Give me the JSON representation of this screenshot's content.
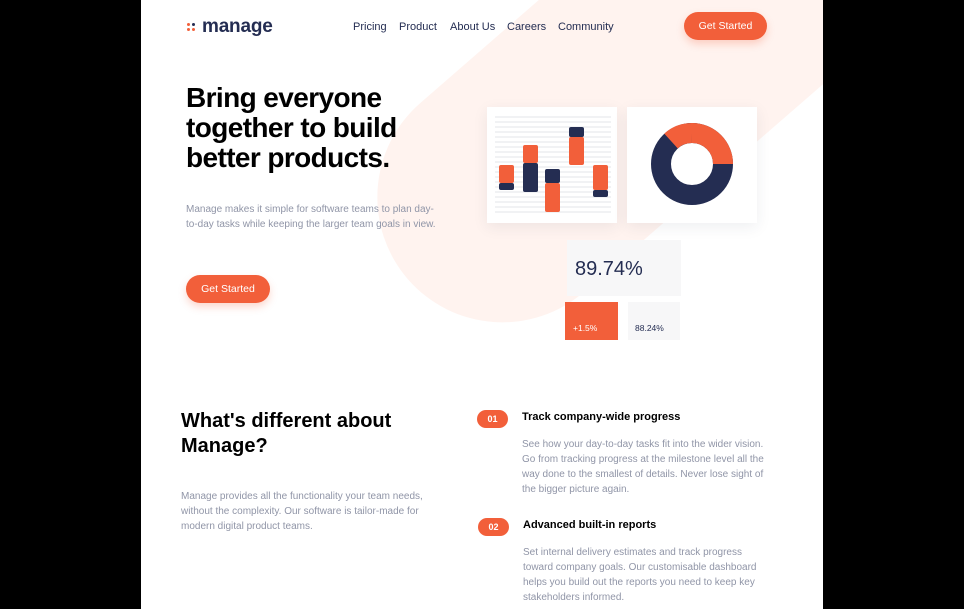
{
  "colors": {
    "accent": "#f25f3a",
    "navy": "#242d52",
    "muted": "#9095a7",
    "blob": "#fff3ef"
  },
  "header": {
    "logo_text": "manage",
    "nav": [
      "Pricing",
      "Product",
      "About Us",
      "Careers",
      "Community"
    ],
    "cta_label": "Get Started"
  },
  "hero": {
    "title": "Bring everyone together to build better products.",
    "description": "Manage makes it simple for software teams to plan day-to-day tasks while keeping the larger team goals in view.",
    "cta_label": "Get Started",
    "stats": {
      "main": "89.74%",
      "change": "+1.5%",
      "secondary": "88.24%"
    }
  },
  "features": {
    "title": "What's different about Manage?",
    "description": "Manage provides all the functionality your team needs, without the complexity. Our software is tailor-made for modern digital product teams.",
    "items": [
      {
        "num": "01",
        "title": "Track company-wide progress",
        "desc": "See how your day-to-day tasks fit into the wider vision. Go from tracking progress at the milestone level all the way done to the smallest of details. Never lose sight of the bigger picture again."
      },
      {
        "num": "02",
        "title": "Advanced built-in reports",
        "desc": "Set internal delivery estimates and track progress toward company goals. Our customisable dashboard helps you build out the reports you need to keep key stakeholders informed."
      }
    ]
  }
}
